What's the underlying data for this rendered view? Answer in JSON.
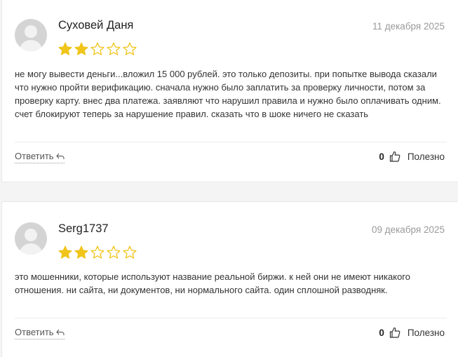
{
  "reviews": [
    {
      "author": "Суховей Даня",
      "date": "11 декабря 2025",
      "rating": 2,
      "max_rating": 5,
      "text": "не могу вывести деньги...вложил 15 000 рублей. это только депозиты. при попытке вывода сказали что нужно пройти верификацию. сначала нужно было заплатить за проверку личности, потом за проверку карту. внес два платежа. заявляют что нарушил правила и нужно было оплачивать одним. счет блокируют теперь за нарушение правил. сказать что в шоке ничего не сказать",
      "reply_label": "Ответить",
      "helpful_count": "0",
      "helpful_label": "Полезно"
    },
    {
      "author": "Serg1737",
      "date": "09 декабря 2025",
      "rating": 2,
      "max_rating": 5,
      "text": "это мошенники, которые используют название реальной биржи. к ней они не имеют никакого отношения. ни сайта, ни документов, ни нормального сайта. один сплошной разводняк.",
      "reply_label": "Ответить",
      "helpful_count": "0",
      "helpful_label": "Полезно"
    }
  ],
  "colors": {
    "star_filled": "#f0c419",
    "star_empty_stroke": "#f0c419"
  },
  "icons": {
    "avatar": "user-avatar-icon",
    "reply": "reply-arrow-icon",
    "helpful": "thumbs-up-icon",
    "star": "star-icon"
  }
}
